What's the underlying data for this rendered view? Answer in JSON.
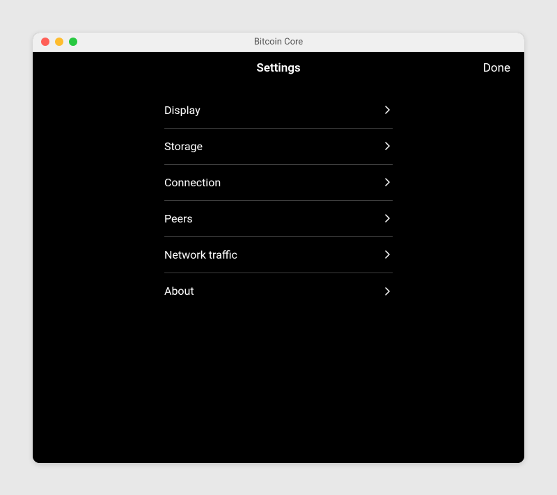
{
  "window": {
    "title": "Bitcoin Core"
  },
  "header": {
    "title": "Settings",
    "done_label": "Done"
  },
  "settings": {
    "items": [
      {
        "label": "Display",
        "key": "display"
      },
      {
        "label": "Storage",
        "key": "storage"
      },
      {
        "label": "Connection",
        "key": "connection"
      },
      {
        "label": "Peers",
        "key": "peers"
      },
      {
        "label": "Network traffic",
        "key": "network-traffic"
      },
      {
        "label": "About",
        "key": "about"
      }
    ]
  }
}
